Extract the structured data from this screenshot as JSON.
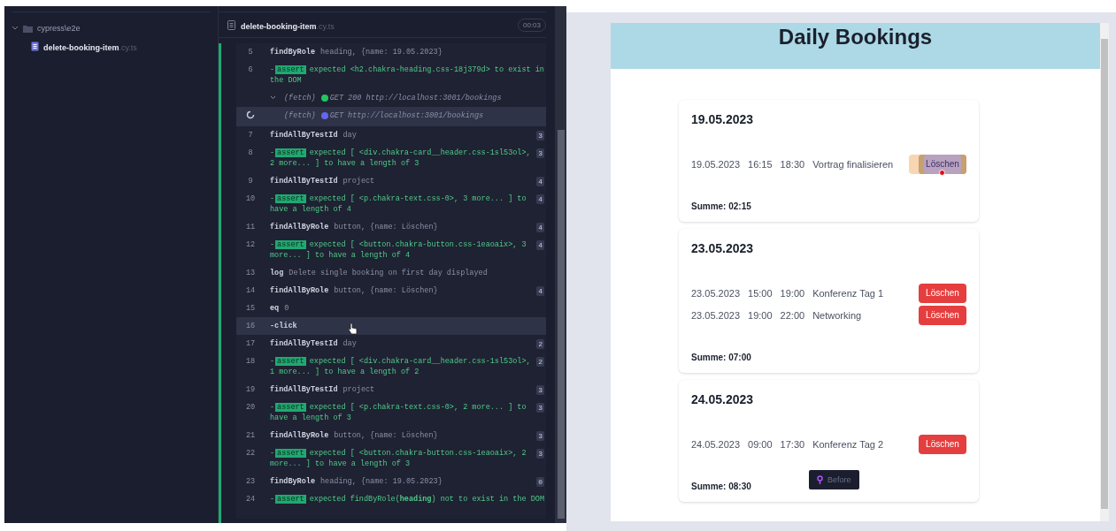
{
  "sidebar": {
    "folder": {
      "name": "cypress\\e2e",
      "expanded": true,
      "children": [
        {
          "name": "delete-booking-item",
          "extension": ".cy.ts",
          "selected": true
        }
      ]
    }
  },
  "command_log": {
    "spec_name": "delete-booking-item",
    "spec_extension": ".cy.ts",
    "duration": "00:03",
    "entries": [
      {
        "kind": "command",
        "number": "5",
        "name": "findByRole",
        "message": "heading, {name: 19.05.2023}",
        "highlighted": false
      },
      {
        "kind": "assert",
        "number": "6",
        "dash": "-",
        "badge": "assert",
        "message": "expected <h2.chakra-heading.css-18j379d> to exist in the DOM",
        "highlighted": false
      },
      {
        "kind": "fetch",
        "label": "(fetch)",
        "message": "GET 200 http://localhost:3001/bookings",
        "color": "#22c55e",
        "expanded": true,
        "pending": false,
        "highlighted": false
      },
      {
        "kind": "fetch",
        "label": "(fetch)",
        "message": "GET http://localhost:3001/bookings",
        "color": "#6366f1",
        "expanded": false,
        "pending": true,
        "highlighted": true
      },
      {
        "kind": "command",
        "number": "7",
        "name": "findAllByTestId",
        "message": "day",
        "count": "3",
        "highlighted": false
      },
      {
        "kind": "assert",
        "number": "8",
        "dash": "-",
        "badge": "assert",
        "message": "expected [ <div.chakra-card__header.css-1sl53ol>, 2 more... ] to have a length of 3",
        "count": "3",
        "highlighted": false
      },
      {
        "kind": "command",
        "number": "9",
        "name": "findAllByTestId",
        "message": "project",
        "count": "4",
        "highlighted": false
      },
      {
        "kind": "assert",
        "number": "10",
        "dash": "-",
        "badge": "assert",
        "message": "expected [ <p.chakra-text.css-0>, 3 more... ] to have a length of 4",
        "count": "4",
        "highlighted": false
      },
      {
        "kind": "command",
        "number": "11",
        "name": "findAllByRole",
        "message": "button, {name: Löschen}",
        "count": "4",
        "highlighted": false
      },
      {
        "kind": "assert",
        "number": "12",
        "dash": "-",
        "badge": "assert",
        "message": "expected [ <button.chakra-button.css-1eaoaix>, 3 more... ] to have a length of 4",
        "count": "4",
        "highlighted": false
      },
      {
        "kind": "command",
        "number": "13",
        "name": "log",
        "message": "Delete single booking on first day displayed",
        "highlighted": false
      },
      {
        "kind": "command",
        "number": "14",
        "name": "findAllByRole",
        "message": "button, {name: Löschen}",
        "count": "4",
        "highlighted": false
      },
      {
        "kind": "command",
        "number": "15",
        "name": "eq",
        "message": "0",
        "highlighted": false
      },
      {
        "kind": "command",
        "number": "16",
        "name": "-click",
        "highlighted": true
      },
      {
        "kind": "command",
        "number": "17",
        "name": "findAllByTestId",
        "message": "day",
        "count": "2",
        "highlighted": false
      },
      {
        "kind": "assert",
        "number": "18",
        "dash": "-",
        "badge": "assert",
        "message": "expected [ <div.chakra-card__header.css-1sl53ol>, 1 more... ] to have a length of 2",
        "count": "2",
        "highlighted": false
      },
      {
        "kind": "command",
        "number": "19",
        "name": "findAllByTestId",
        "message": "project",
        "count": "3",
        "highlighted": false
      },
      {
        "kind": "assert",
        "number": "20",
        "dash": "-",
        "badge": "assert",
        "message": "expected [ <p.chakra-text.css-0>, 2 more... ] to have a length of 3",
        "count": "3",
        "highlighted": false
      },
      {
        "kind": "command",
        "number": "21",
        "name": "findAllByRole",
        "message": "button, {name: Löschen}",
        "count": "3",
        "highlighted": false
      },
      {
        "kind": "assert",
        "number": "22",
        "dash": "-",
        "badge": "assert",
        "message": "expected [ <button.chakra-button.css-1eaoaix>, 2 more... ] to have a length of 3",
        "count": "3",
        "highlighted": false
      },
      {
        "kind": "command",
        "number": "23",
        "name": "findByRole",
        "message": "heading, {name: 19.05.2023}",
        "count": "0",
        "highlighted": false
      },
      {
        "kind": "assert",
        "number": "24",
        "dash": "-",
        "badge": "assert",
        "message": "expected findByRole(**heading**) not to exist in the DOM",
        "highlighted": false
      }
    ]
  },
  "app": {
    "title": "Daily Bookings",
    "days": [
      {
        "date": "19.05.2023",
        "bookings": [
          {
            "date": "19.05.2023",
            "start": "16:15",
            "end": "18:30",
            "project": "Vortrag finalisieren",
            "button": "Löschen",
            "highlighted": true
          }
        ],
        "sum": "Summe: 02:15"
      },
      {
        "date": "23.05.2023",
        "bookings": [
          {
            "date": "23.05.2023",
            "start": "15:00",
            "end": "19:00",
            "project": "Konferenz Tag 1",
            "button": "Löschen",
            "highlighted": false
          },
          {
            "date": "23.05.2023",
            "start": "19:00",
            "end": "22:00",
            "project": "Networking",
            "button": "Löschen",
            "highlighted": false
          }
        ],
        "sum": "Summe: 07:00"
      },
      {
        "date": "24.05.2023",
        "bookings": [
          {
            "date": "24.05.2023",
            "start": "09:00",
            "end": "17:30",
            "project": "Konferenz Tag 2",
            "button": "Löschen",
            "highlighted": false
          }
        ],
        "sum": "Summe: 08:30"
      }
    ],
    "snapshot_tooltip": "Before"
  }
}
